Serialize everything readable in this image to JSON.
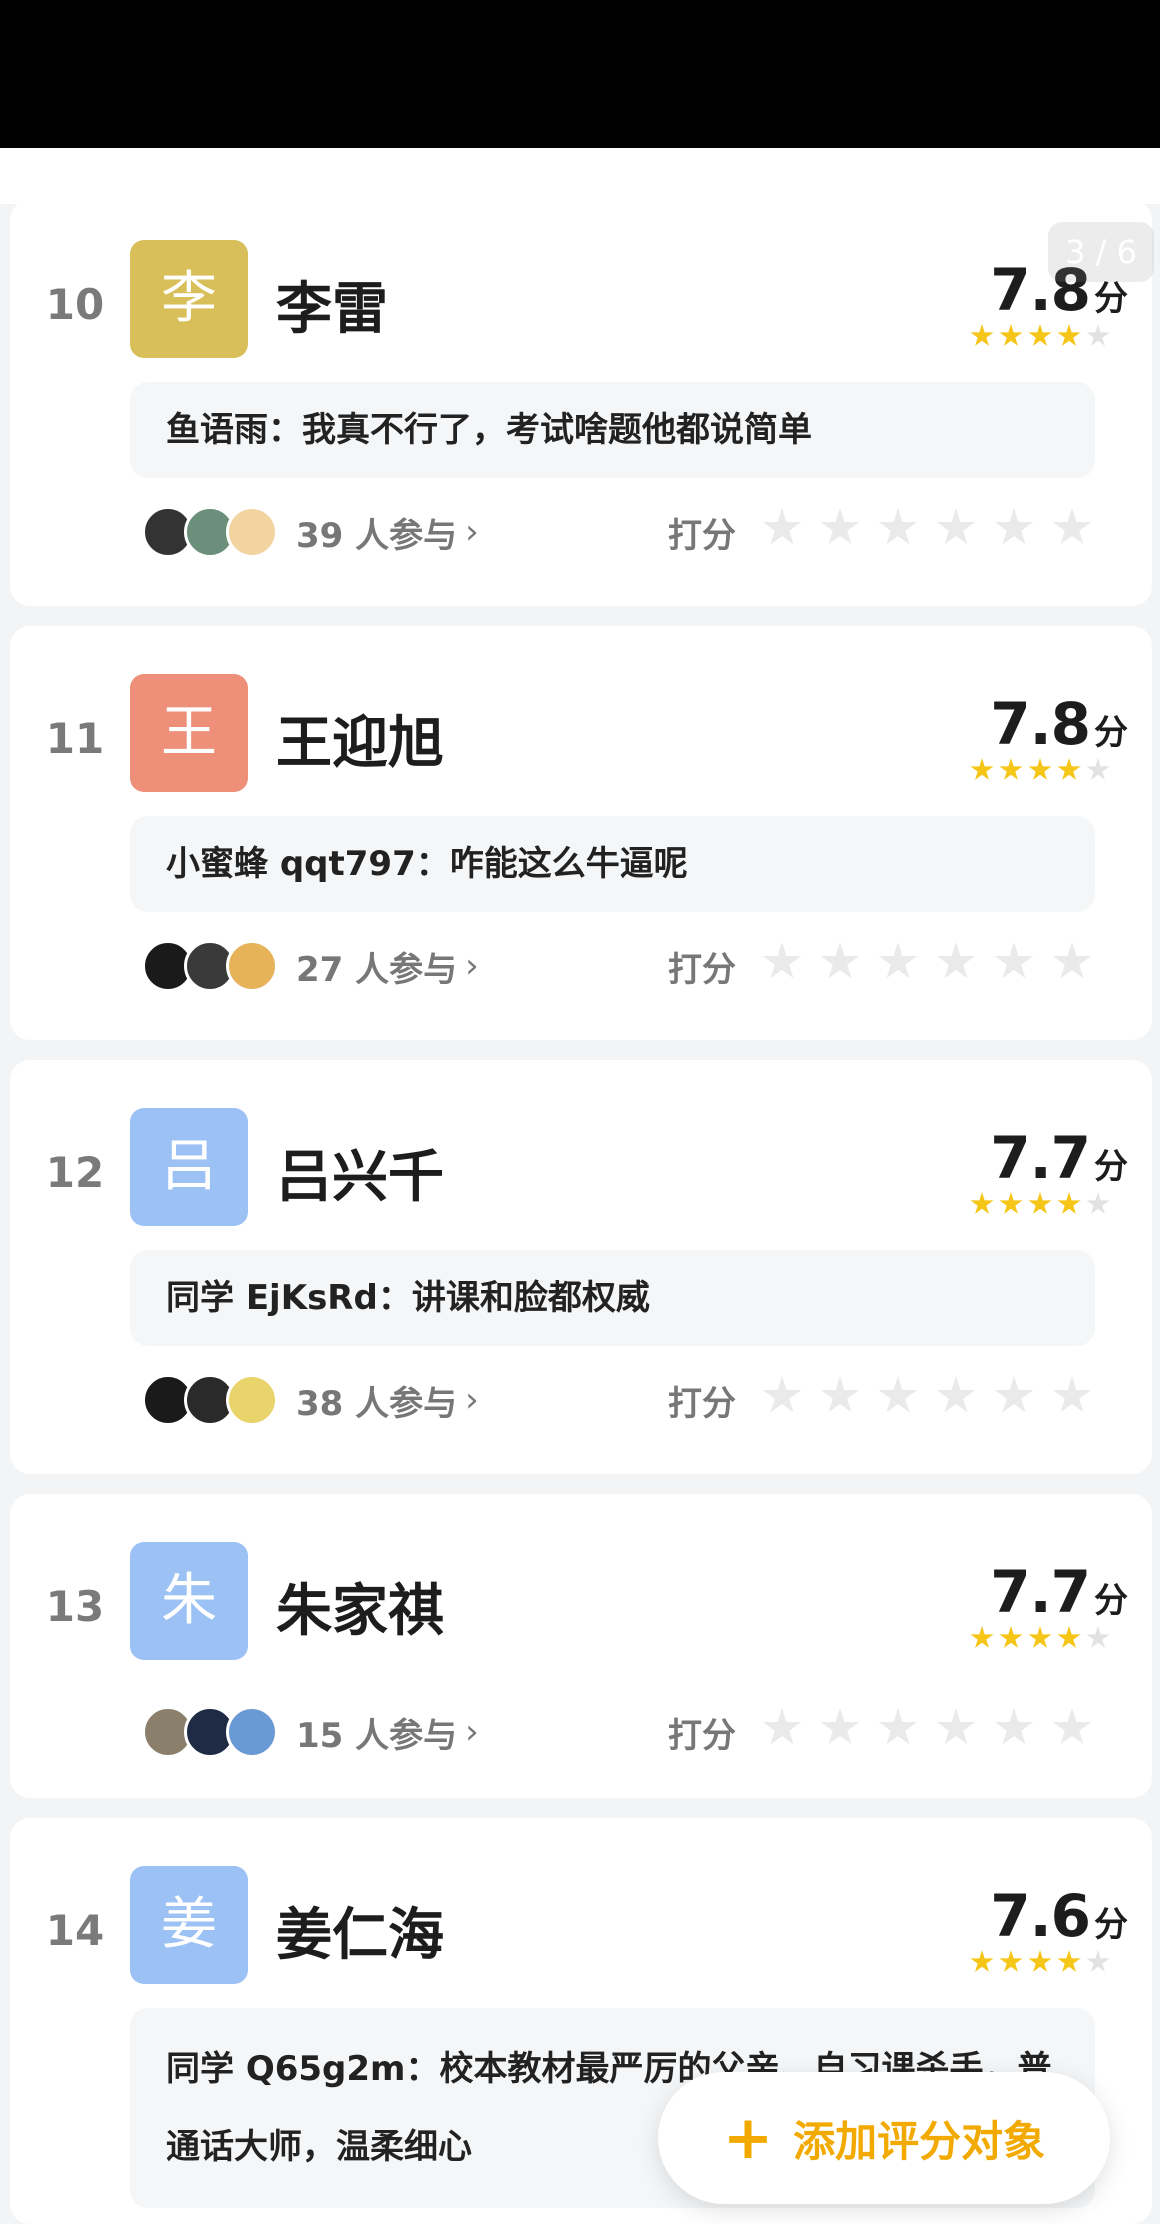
{
  "pager": {
    "text": "3 / 6"
  },
  "cards": [
    {
      "rank": "10",
      "initial": "李",
      "name": "李雷",
      "score": "7.8",
      "unit": "分",
      "stars": 4,
      "avatar_color": "#d9bf59",
      "comment": "鱼语雨：我真不行了，考试啥题他都说简单",
      "participants": "39 人参与",
      "rate_label": "打分"
    },
    {
      "rank": "11",
      "initial": "王",
      "name": "王迎旭",
      "score": "7.8",
      "unit": "分",
      "stars": 4,
      "avatar_color": "#ee8f7a",
      "comment": "小蜜蜂 qqt797：咋能这么牛逼呢",
      "participants": "27 人参与",
      "rate_label": "打分"
    },
    {
      "rank": "12",
      "initial": "吕",
      "name": "吕兴千",
      "score": "7.7",
      "unit": "分",
      "stars": 4,
      "avatar_color": "#9cc1f4",
      "comment": "同学 EjKsRd：讲课和脸都权威",
      "participants": "38 人参与",
      "rate_label": "打分"
    },
    {
      "rank": "13",
      "initial": "朱",
      "name": "朱家祺",
      "score": "7.7",
      "unit": "分",
      "stars": 4,
      "avatar_color": "#9cc1f4",
      "comment": "",
      "participants": "15 人参与",
      "rate_label": "打分"
    },
    {
      "rank": "14",
      "initial": "姜",
      "name": "姜仁海",
      "score": "7.6",
      "unit": "分",
      "stars": 4,
      "avatar_color": "#9cc1f4",
      "comment": "同学 Q65g2m：校本教材最严厉的父亲、自习课杀手，普通话大师，温柔细心",
      "participants": "",
      "rate_label": ""
    }
  ],
  "fab": {
    "plus": "+",
    "label": "添加评分对象"
  },
  "colors": {
    "star_on": "#f5c518",
    "star_off": "#e2e2e2",
    "fab_accent": "#f2a900"
  }
}
